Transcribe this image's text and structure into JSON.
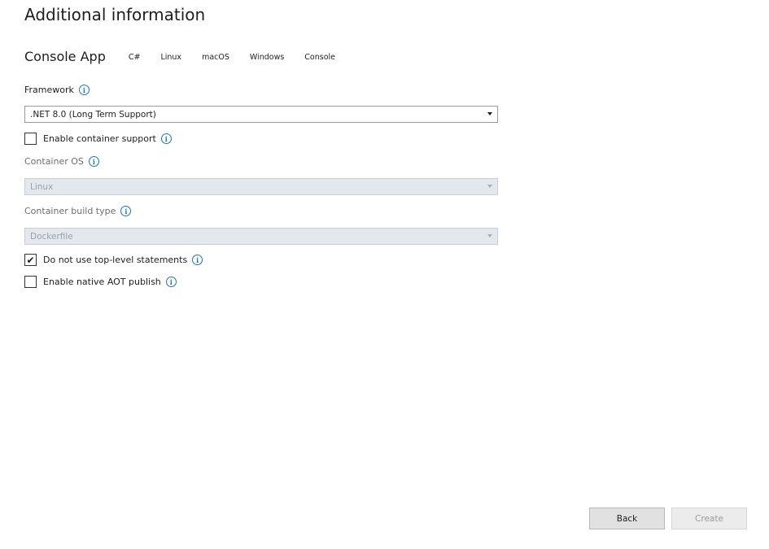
{
  "header": {
    "title": "Additional information",
    "app_name": "Console App",
    "tags": [
      "C#",
      "Linux",
      "macOS",
      "Windows",
      "Console"
    ]
  },
  "framework": {
    "label": "Framework",
    "selected": ".NET 8.0 (Long Term Support)"
  },
  "container_support": {
    "label": "Enable container support",
    "checked": false
  },
  "container_os": {
    "label": "Container OS",
    "selected": "Linux",
    "disabled": true
  },
  "container_build_type": {
    "label": "Container build type",
    "selected": "Dockerfile",
    "disabled": true
  },
  "top_level_statements": {
    "label": "Do not use top-level statements",
    "checked": true
  },
  "native_aot": {
    "label": "Enable native AOT publish",
    "checked": false
  },
  "footer": {
    "back_label": "Back",
    "create_label": "Create"
  },
  "icons": {
    "info": "info-icon",
    "checkmark": "checkmark-icon",
    "dropdown": "chevron-down-icon"
  },
  "colors": {
    "accent": "#1a73c8",
    "disabled_field": "#e3e8ef"
  }
}
